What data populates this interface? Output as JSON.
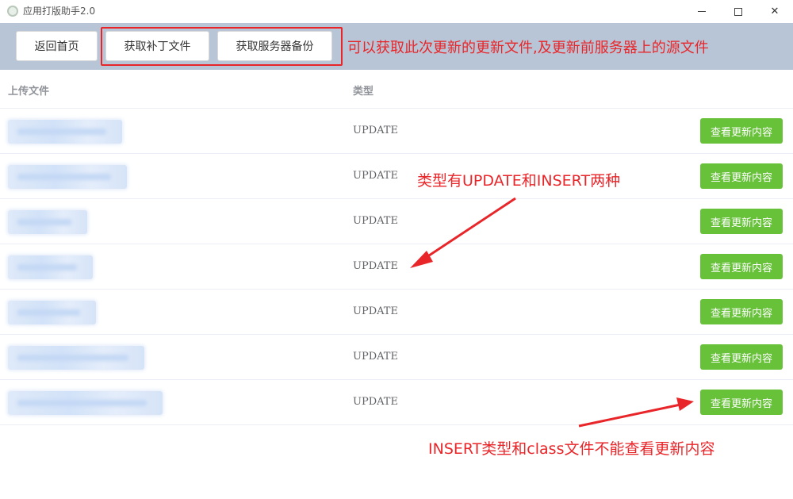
{
  "window": {
    "title": "应用打版助手2.0",
    "icon": "app-logo-icon"
  },
  "toolbar": {
    "home_label": "返回首页",
    "patch_label": "获取补丁文件",
    "backup_label": "获取服务器备份"
  },
  "annotations": {
    "top_note": "可以获取此次更新的更新文件,及更新前服务器上的源文件",
    "types_note": "类型有UPDATE和INSERT两种",
    "insert_note": "INSERT类型和class文件不能查看更新内容",
    "color": "#e8262a"
  },
  "table": {
    "headers": {
      "file": "上传文件",
      "type": "类型"
    },
    "rows": [
      {
        "type": "UPDATE",
        "action": "查看更新内容"
      },
      {
        "type": "UPDATE",
        "action": "查看更新内容"
      },
      {
        "type": "UPDATE",
        "action": "查看更新内容"
      },
      {
        "type": "UPDATE",
        "action": "查看更新内容"
      },
      {
        "type": "UPDATE",
        "action": "查看更新内容"
      },
      {
        "type": "UPDATE",
        "action": "查看更新内容"
      },
      {
        "type": "UPDATE",
        "action": "查看更新内容"
      }
    ]
  },
  "colors": {
    "toolbar_bg": "#b8c5d6",
    "action_button": "#67c23a"
  }
}
